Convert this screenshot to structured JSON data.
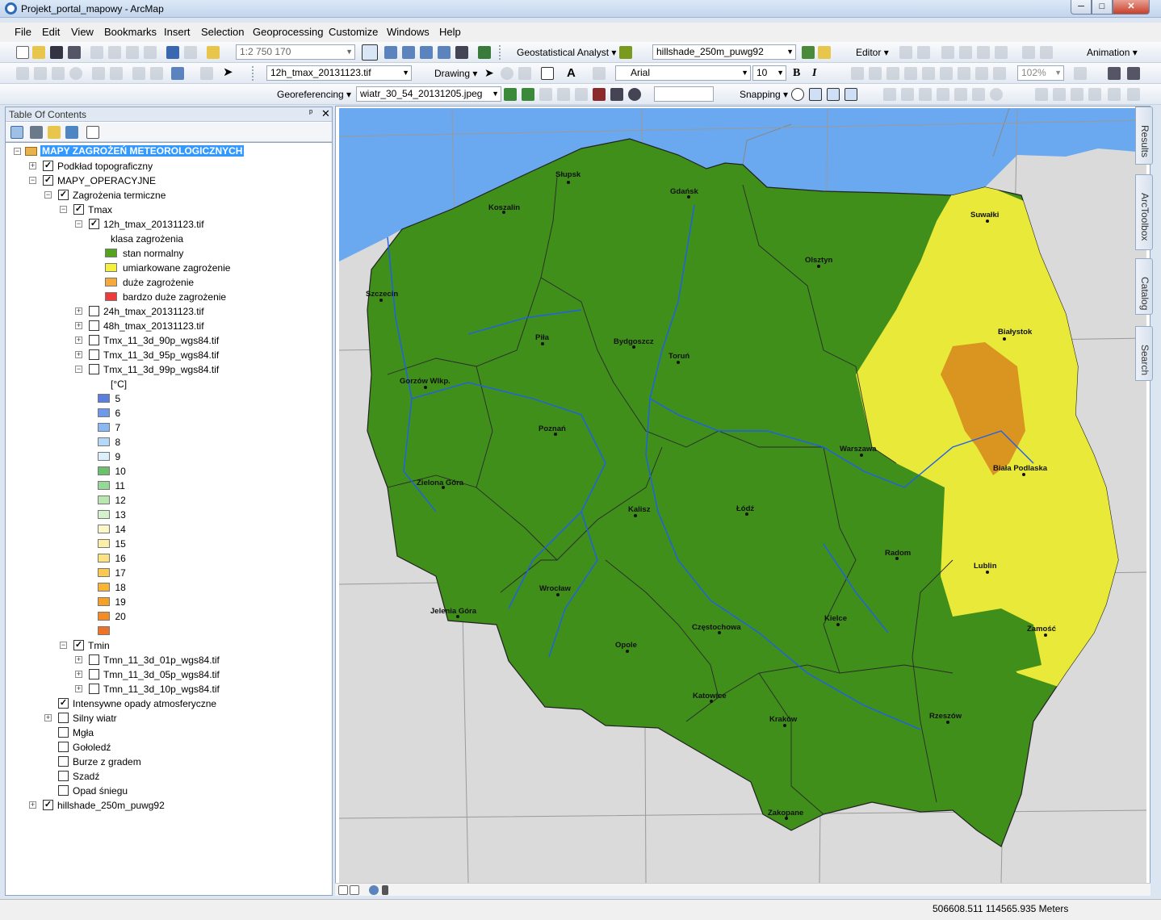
{
  "window": {
    "title": "Projekt_portal_mapowy - ArcMap",
    "btn_min": "─",
    "btn_max": "□",
    "btn_close": "✕"
  },
  "menu": [
    "File",
    "Edit",
    "View",
    "Bookmarks",
    "Insert",
    "Selection",
    "Geoprocessing",
    "Customize",
    "Windows",
    "Help"
  ],
  "toolbar": {
    "scale": "1:2 750 170",
    "geostat": "Geostatistical Analyst",
    "layer_combo": "hillshade_250m_puwg92",
    "editor": "Editor",
    "animation": "Animation",
    "target_layer": "12h_tmax_20131123.tif",
    "drawing": "Drawing",
    "font": "Arial",
    "font_size": "10",
    "bold": "B",
    "italic": "I",
    "zoom": "102%",
    "georeferencing": "Georeferencing",
    "georef_layer": "wiatr_30_54_20131205.jpeg",
    "snapping": "Snapping"
  },
  "toc": {
    "title": "Table Of Contents",
    "pin": "ᵖ",
    "close": "✕",
    "rows": [
      {
        "label": "MAPY ZAGROŻEŃ METEOROLOGICZNYCH",
        "indent": 0,
        "exp": "-",
        "chk": null,
        "root": true
      },
      {
        "label": "Podkład topograficzny",
        "indent": 1,
        "exp": "+",
        "chk": true
      },
      {
        "label": "MAPY_OPERACYJNE",
        "indent": 1,
        "exp": "-",
        "chk": true
      },
      {
        "label": "Zagrożenia termiczne",
        "indent": 2,
        "exp": "-",
        "chk": true
      },
      {
        "label": "Tmax",
        "indent": 3,
        "exp": "-",
        "chk": true
      },
      {
        "label": "12h_tmax_20131123.tif",
        "indent": 4,
        "exp": "-",
        "chk": true
      },
      {
        "label": "klasa zagrożenia",
        "indent": 5,
        "exp": null,
        "chk": null
      },
      {
        "label": "stan normalny",
        "indent": 5,
        "swatch": "#54a31e"
      },
      {
        "label": "umiarkowane zagrożenie",
        "indent": 5,
        "swatch": "#f5f03c"
      },
      {
        "label": "duże zagrożenie",
        "indent": 5,
        "swatch": "#f5a93c"
      },
      {
        "label": "bardzo duże zagrożenie",
        "indent": 5,
        "swatch": "#ee3a3a"
      },
      {
        "label": "24h_tmax_20131123.tif",
        "indent": 4,
        "exp": "+",
        "chk": false
      },
      {
        "label": "48h_tmax_20131123.tif",
        "indent": 4,
        "exp": "+",
        "chk": false
      },
      {
        "label": "Tmx_11_3d_90p_wgs84.tif",
        "indent": 4,
        "exp": "+",
        "chk": false
      },
      {
        "label": "Tmx_11_3d_95p_wgs84.tif",
        "indent": 4,
        "exp": "+",
        "chk": false
      },
      {
        "label": "Tmx_11_3d_99p_wgs84.tif",
        "indent": 4,
        "exp": "-",
        "chk": false
      },
      {
        "label": "[°C]",
        "indent": 5
      },
      {
        "label": "5",
        "indent": 4.5,
        "swatch": "#5b7fe0"
      },
      {
        "label": "6",
        "indent": 4.5,
        "swatch": "#6e98ea"
      },
      {
        "label": "7",
        "indent": 4.5,
        "swatch": "#8ab8f2"
      },
      {
        "label": "8",
        "indent": 4.5,
        "swatch": "#b4d8f6"
      },
      {
        "label": "9",
        "indent": 4.5,
        "swatch": "#dcf0fb"
      },
      {
        "label": "10",
        "indent": 4.5,
        "swatch": "#6cc06c"
      },
      {
        "label": "11",
        "indent": 4.5,
        "swatch": "#96d896"
      },
      {
        "label": "12",
        "indent": 4.5,
        "swatch": "#b8e8b0"
      },
      {
        "label": "13",
        "indent": 4.5,
        "swatch": "#d4f2cc"
      },
      {
        "label": "14",
        "indent": 4.5,
        "swatch": "#fbf7c8"
      },
      {
        "label": "15",
        "indent": 4.5,
        "swatch": "#fbeea6"
      },
      {
        "label": "16",
        "indent": 4.5,
        "swatch": "#fbe282"
      },
      {
        "label": "17",
        "indent": 4.5,
        "swatch": "#fbc850"
      },
      {
        "label": "18",
        "indent": 4.5,
        "swatch": "#f9b434"
      },
      {
        "label": "19",
        "indent": 4.5,
        "swatch": "#f7a028"
      },
      {
        "label": "20",
        "indent": 4.5,
        "swatch": "#f38c24"
      },
      {
        "label": "",
        "indent": 4.5,
        "swatch": "#ee7228"
      },
      {
        "label": "Tmin",
        "indent": 3,
        "exp": "-",
        "chk": true
      },
      {
        "label": "Tmn_11_3d_01p_wgs84.tif",
        "indent": 4,
        "exp": "+",
        "chk": false
      },
      {
        "label": "Tmn_11_3d_05p_wgs84.tif",
        "indent": 4,
        "exp": "+",
        "chk": false
      },
      {
        "label": "Tmn_11_3d_10p_wgs84.tif",
        "indent": 4,
        "exp": "+",
        "chk": false
      },
      {
        "label": "Intensywne opady atmosferyczne",
        "indent": 2,
        "exp": null,
        "chk": true
      },
      {
        "label": "Silny wiatr",
        "indent": 2,
        "exp": "+",
        "chk": false
      },
      {
        "label": "Mgła",
        "indent": 2,
        "exp": null,
        "chk": false
      },
      {
        "label": "Gołoledź",
        "indent": 2,
        "exp": null,
        "chk": false
      },
      {
        "label": "Burze z gradem",
        "indent": 2,
        "exp": null,
        "chk": false
      },
      {
        "label": "Szadź",
        "indent": 2,
        "exp": null,
        "chk": false
      },
      {
        "label": "Opad śniegu",
        "indent": 2,
        "exp": null,
        "chk": false
      },
      {
        "label": "hillshade_250m_puwg92",
        "indent": 1,
        "exp": "+",
        "chk": true
      }
    ]
  },
  "dock": [
    "Results",
    "ArcToolbox",
    "Catalog",
    "Search"
  ],
  "map": {
    "colors": {
      "sea": "#6aa8ef",
      "land_outside": "#dadada",
      "normal": "#3f8f1a",
      "moderate": "#e9e93a",
      "high": "#d9951f"
    },
    "cities": [
      "Słupsk",
      "Gdańsk",
      "Koszalin",
      "Suwałki",
      "Olsztyn",
      "Szczecin",
      "Piła",
      "Bydgoszcz",
      "Toruń",
      "Białystok",
      "Gorzów Wlkp.",
      "Poznań",
      "Warszawa",
      "Biała Podlaska",
      "Zielona Góra",
      "Kalisz",
      "Łódź",
      "Radom",
      "Lublin",
      "Wrocław",
      "Jelenia Góra",
      "Kielce",
      "Częstochowa",
      "Zamość",
      "Opole",
      "Katowice",
      "Rzeszów",
      "Kraków",
      "Zakopane"
    ]
  },
  "status": {
    "coords": "506608.511  114565.935 Meters"
  }
}
